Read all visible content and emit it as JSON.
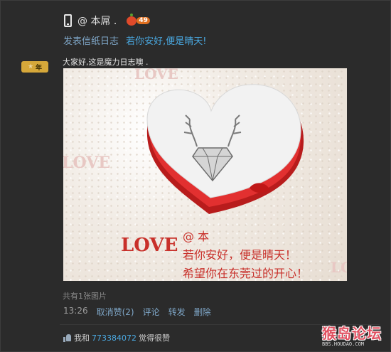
{
  "header": {
    "username": "@ 本屌 .",
    "level": "49"
  },
  "post": {
    "action": "发表信纸日志",
    "title": "若你安好,便是晴天!",
    "year_badge": "年",
    "text": "大家好,这是魔力日志噢 .",
    "photo": {
      "watermark_words": [
        "LOVE",
        "LOVE",
        "LOVE"
      ],
      "main_love": "LOVE",
      "caption_lines": [
        "@  本",
        "若你安好，便是晴天！",
        "希望你在东莞过的开心！"
      ]
    },
    "image_count": "共有1张图片",
    "time": "13:26",
    "actions": [
      "取消赞(2)",
      "评论",
      "转发",
      "删除"
    ]
  },
  "likes": {
    "prefix": "我和",
    "user_id": "773384072",
    "suffix": "觉得很赞"
  },
  "watermark": {
    "logo": "猴岛论坛",
    "url": "BBS.HOUDAO.COM"
  },
  "colors": {
    "background": "#2b2b2b",
    "link": "#7fa7c8",
    "highlight": "#4aa8e0",
    "love_red": "#c8302a"
  }
}
